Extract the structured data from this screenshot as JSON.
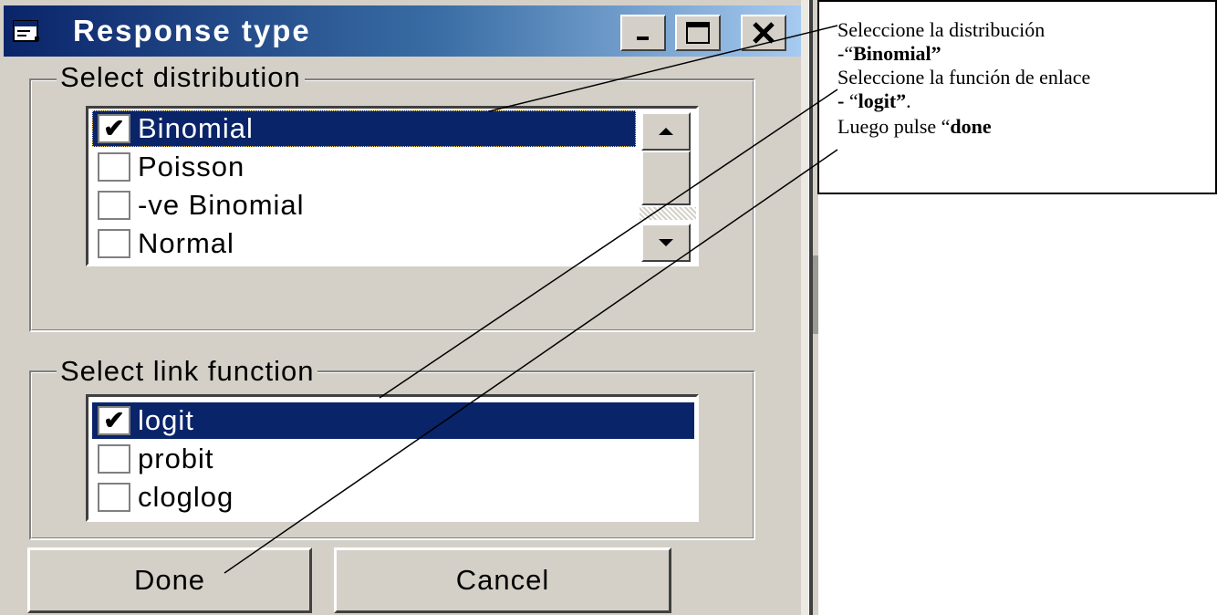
{
  "dialog": {
    "title": "Response type",
    "distribution_group": {
      "label": "Select distribution",
      "items": [
        {
          "label": "Binomial",
          "checked": true,
          "selected": true
        },
        {
          "label": "Poisson",
          "checked": false,
          "selected": false
        },
        {
          "label": "-ve Binomial",
          "checked": false,
          "selected": false
        },
        {
          "label": "Normal",
          "checked": false,
          "selected": false
        }
      ]
    },
    "link_group": {
      "label": "Select link function",
      "items": [
        {
          "label": "logit",
          "checked": true,
          "selected": true
        },
        {
          "label": "probit",
          "checked": false,
          "selected": false
        },
        {
          "label": "cloglog",
          "checked": false,
          "selected": false
        }
      ]
    },
    "done_label": "Done",
    "cancel_label": "Cancel",
    "icons": {
      "title": "window-icon",
      "minimize": "minimize-icon",
      "maximize": "maximize-icon",
      "close": "close-icon",
      "scroll_up": "arrow-up-icon",
      "scroll_down": "arrow-down-icon",
      "check": "check-icon"
    },
    "colors": {
      "face": "#d4d0c8",
      "selection": "#0a246a",
      "title_start": "#0a246a",
      "title_end": "#a6caf0"
    }
  },
  "annotation": {
    "line1": "Seleccione la distribución",
    "line2_prefix": "-“",
    "line2_bold": "Binomial”",
    "line3": "Seleccione la función de enlace",
    "line4_bold": " - ",
    "line4_mid": "“",
    "line4_bold2": "logit”",
    "line4_end": ".",
    "line5_prefix": "Luego  pulse “",
    "line5_bold": "done"
  }
}
